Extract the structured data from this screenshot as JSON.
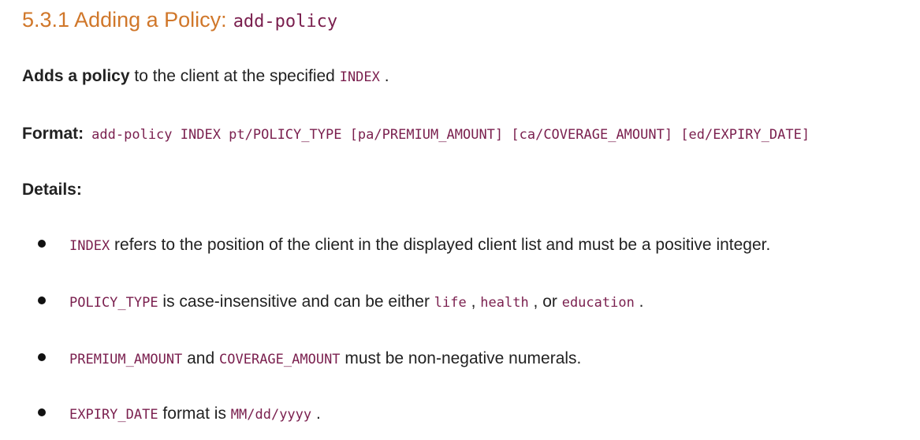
{
  "heading": {
    "title": "5.3.1 Adding a Policy:",
    "command": "add-policy"
  },
  "summary": {
    "bold": "Adds a policy",
    "text": " to the client at the specified ",
    "code": "INDEX",
    "end": " ."
  },
  "format": {
    "label": "Format:",
    "code": "add-policy INDEX pt/POLICY_TYPE [pa/PREMIUM_AMOUNT] [ca/COVERAGE_AMOUNT] [ed/EXPIRY_DATE]"
  },
  "details": {
    "label": "Details:"
  },
  "bullets": {
    "b1": {
      "code": "INDEX",
      "text": " refers to the position of the client in the displayed client list and must be a positive integer."
    },
    "b2": {
      "code": "POLICY_TYPE",
      "text1": " is case-insensitive and can be either ",
      "code2": "life",
      "text2": " , ",
      "code3": "health",
      "text3": " , or ",
      "code4": "education",
      "text4": " ."
    },
    "b3": {
      "code": "PREMIUM_AMOUNT",
      "text1": " and ",
      "code2": "COVERAGE_AMOUNT",
      "text2": " must be non-negative numerals."
    },
    "b4": {
      "code": "EXPIRY_DATE",
      "text1": " format is ",
      "code2": "MM/dd/yyyy",
      "text2": " ."
    }
  }
}
